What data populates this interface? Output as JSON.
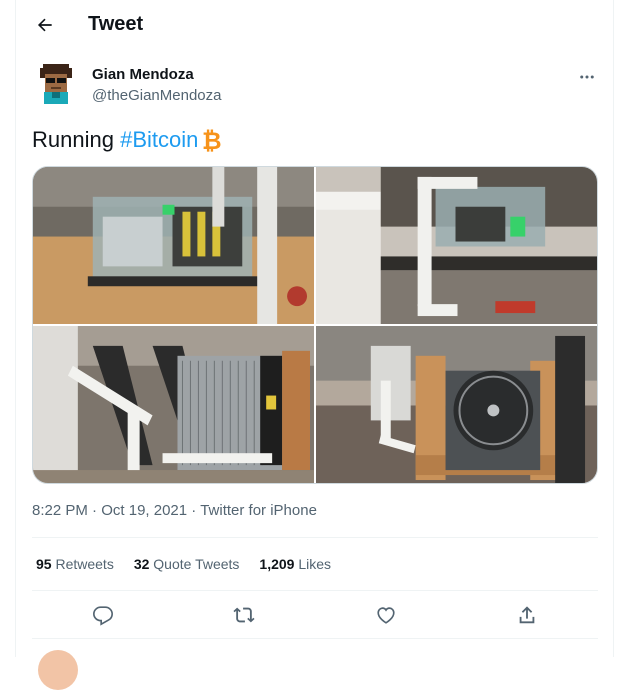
{
  "header": {
    "title": "Tweet",
    "back_icon": "arrow-left-icon"
  },
  "author": {
    "display_name": "Gian Mendoza",
    "handle": "@theGianMendoza"
  },
  "tweet": {
    "text_prefix": "Running ",
    "hashtag": "#Bitcoin",
    "emoji_icon": "bitcoin-icon",
    "media": [
      {
        "alt": "mining rig in liquid tank on shelf"
      },
      {
        "alt": "tank with pvc pipes on shelf"
      },
      {
        "alt": "radiator with pipes outside"
      },
      {
        "alt": "radiator with fan in wooden frame"
      }
    ]
  },
  "meta": {
    "time": "8:22 PM",
    "sep1": " · ",
    "date": "Oct 19, 2021",
    "sep2": " · ",
    "source": "Twitter for iPhone"
  },
  "stats": {
    "retweets_count": "95",
    "retweets_label": " Retweets",
    "quotes_count": "32",
    "quotes_label": " Quote Tweets",
    "likes_count": "1,209",
    "likes_label": " Likes"
  },
  "actions": [
    "reply-icon",
    "retweet-icon",
    "like-icon",
    "share-icon"
  ],
  "colors": {
    "accent": "#1d9bf0",
    "muted": "#536471",
    "bitcoin": "#f7931a",
    "border": "#eff3f4"
  }
}
